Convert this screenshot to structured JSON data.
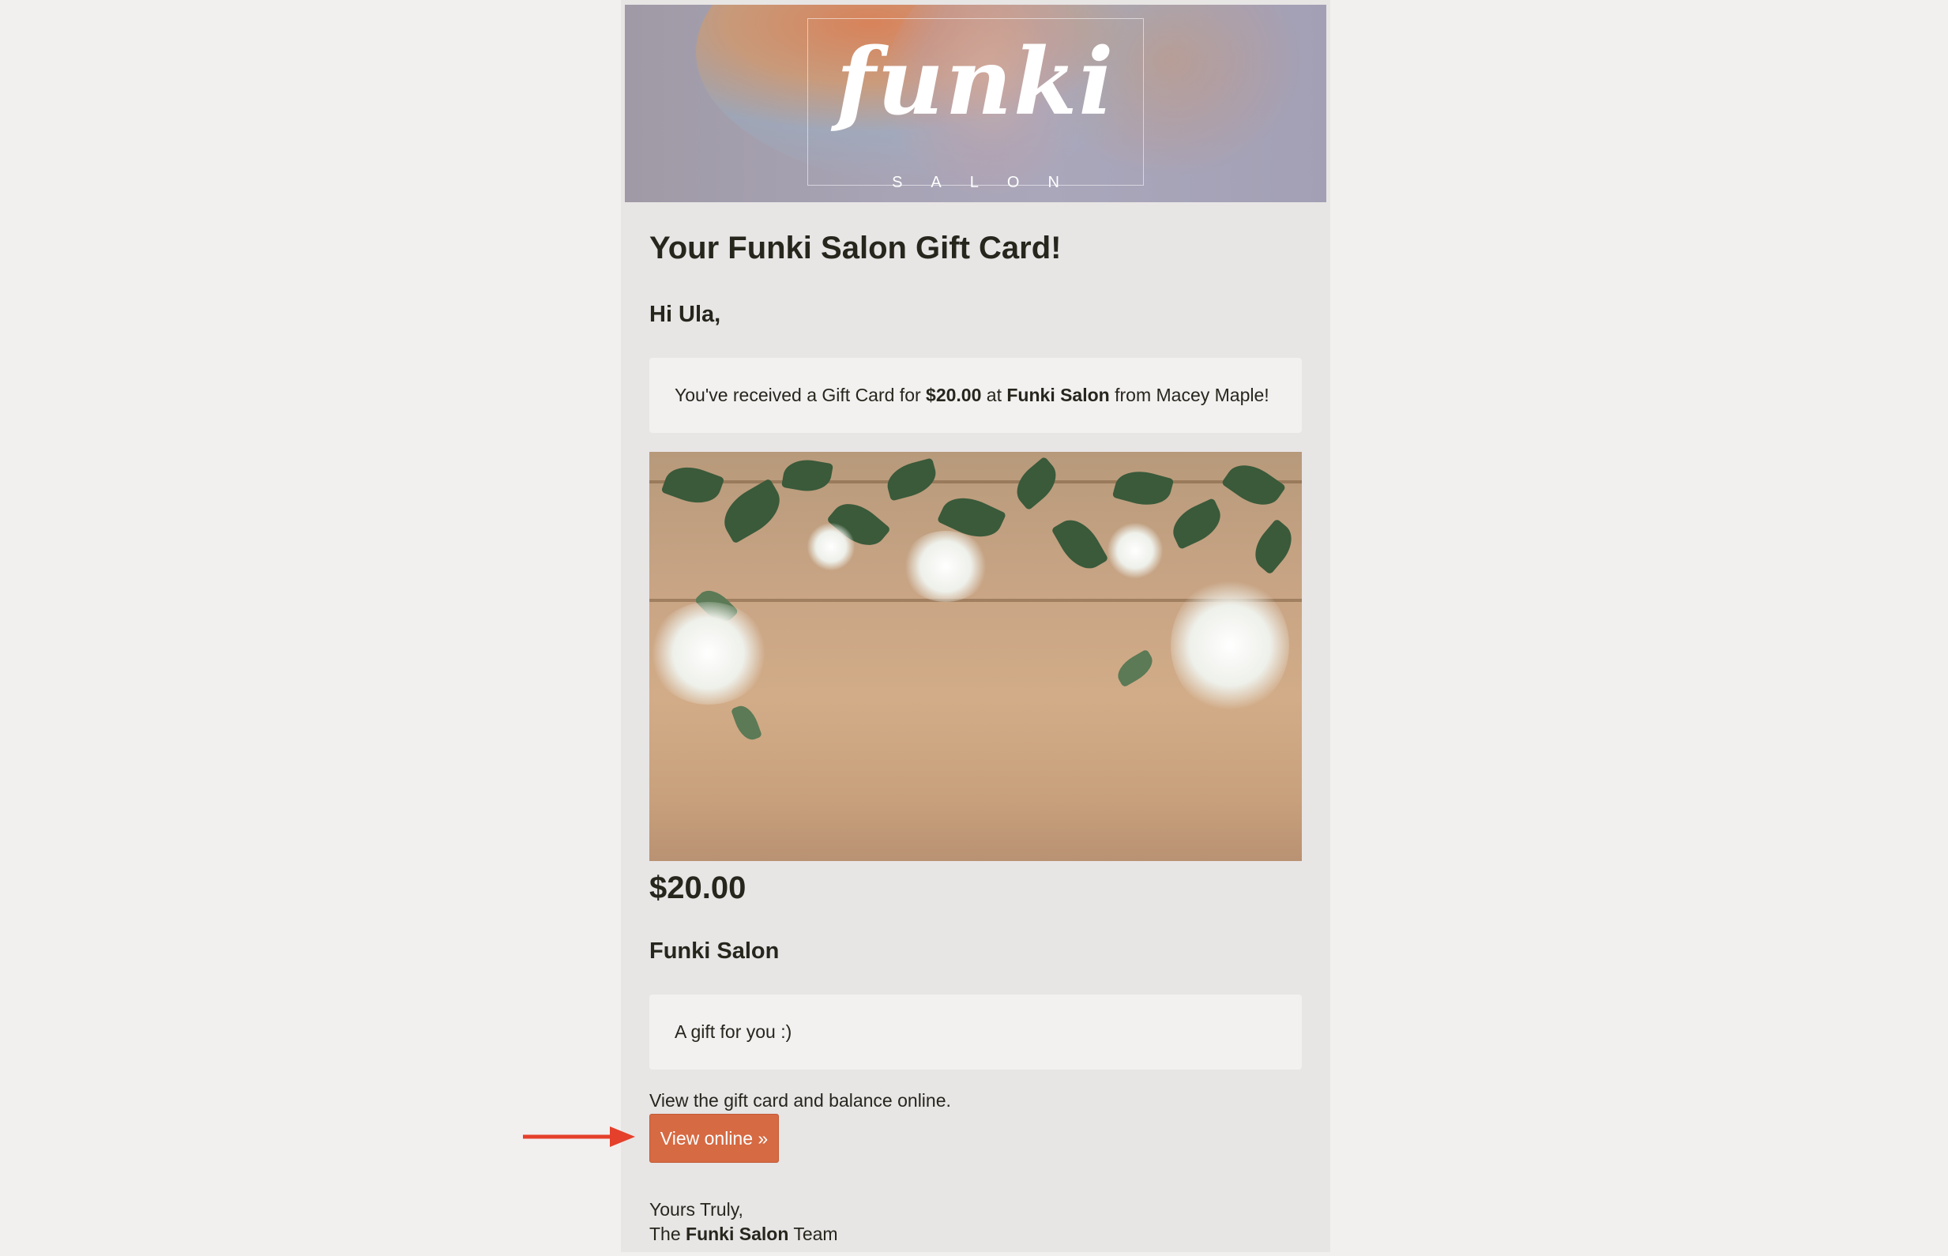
{
  "header": {
    "logo_text": "funki",
    "logo_subtext": "SALON"
  },
  "email": {
    "title": "Your Funki Salon Gift Card!",
    "greeting": "Hi Ula,",
    "message": {
      "prefix": "You've received a Gift Card for ",
      "amount": "$20.00",
      "middle": " at ",
      "business": "Funki Salon",
      "suffix": " from Macey Maple!"
    },
    "card": {
      "amount": "$20.00",
      "business_name": "Funki Salon",
      "note": "A gift for you :)"
    },
    "view_text": "View the gift card and balance online.",
    "view_button_label": "View online »",
    "signoff": {
      "line1": "Yours Truly,",
      "prefix": "The ",
      "business": "Funki Salon",
      "suffix": " Team"
    }
  },
  "colors": {
    "page_background": "#f2efef",
    "email_background": "#e8e5e5",
    "box_background": "#f3f0f0",
    "button": "#d66a43",
    "arrow": "#e4402b",
    "text": "#26261d"
  }
}
